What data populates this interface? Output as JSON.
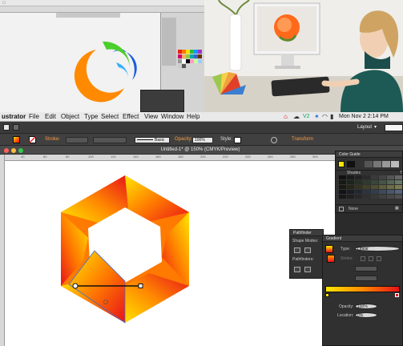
{
  "menubar": {
    "app_name": "ustrator",
    "items": [
      "File",
      "Edit",
      "Object",
      "Type",
      "Select",
      "Effect",
      "View",
      "Window",
      "Help"
    ],
    "status_badge": "V2",
    "datetime": "Mon Nov 2  2:14 PM"
  },
  "control_bar": {
    "workspace_label": "Layout",
    "stroke_label": "Stroke:",
    "brush_label": "Basic",
    "opacity_label": "Opacity:",
    "opacity_value": "100%",
    "style_label": "Style:",
    "transform_label": "Transform"
  },
  "document": {
    "tab_title": "Untitled-1* @ 150% (CMYK/Preview)",
    "ruler_ticks": [
      "40",
      "60",
      "80",
      "100",
      "120",
      "140",
      "160",
      "180",
      "200",
      "220",
      "240",
      "260",
      "280",
      "300",
      "320"
    ]
  },
  "color_guide": {
    "title": "Color Guide",
    "shades_label": "Shades",
    "tints_label": "T",
    "none_label": "None"
  },
  "pathfinder": {
    "title": "Pathfinder",
    "shape_modes_label": "Shape Modes:",
    "pathfinders_label": "Pathfinders:"
  },
  "gradient": {
    "title": "Gradient",
    "type_label": "Type:",
    "type_value": "Linear",
    "stroke_label": "Stroke:",
    "opacity_label": "Opacity:",
    "opacity_value": "100%",
    "location_label": "Location:",
    "location_value": "0%"
  },
  "colors": {
    "accent_orange": "#ff7a00",
    "gradient_start": "#ffe600",
    "gradient_end": "#e8121a"
  }
}
